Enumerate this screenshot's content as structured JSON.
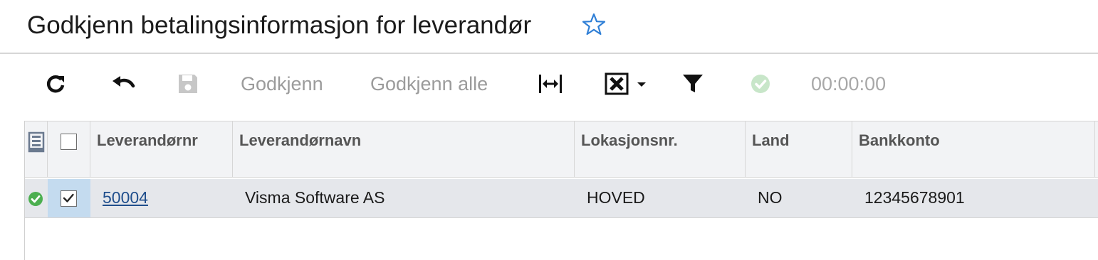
{
  "page": {
    "title": "Godkjenn betalingsinformasjon for leverandør",
    "favorite_icon": "star-outline-icon",
    "accent_color": "#2f7fd6"
  },
  "toolbar": {
    "refresh_icon": "refresh-icon",
    "undo_icon": "undo-icon",
    "save_icon": "save-icon",
    "approve_label": "Godkjenn",
    "approve_all_label": "Godkjenn alle",
    "fit_columns_icon": "fit-columns-icon",
    "export_icon": "excel-export-icon",
    "filter_icon": "filter-icon",
    "status_icon": "check-circle-icon",
    "timer": "00:00:00"
  },
  "grid": {
    "columns": {
      "vendor_number": "Leverandørnr",
      "vendor_name": "Leverandørnavn",
      "location_number": "Lokasjonsnr.",
      "country": "Land",
      "bank_account": "Bankkonto"
    },
    "rows": [
      {
        "status": "ok",
        "selected": true,
        "vendor_number": "50004",
        "vendor_name": "Visma Software AS",
        "location_number": "HOVED",
        "country": "NO",
        "bank_account": "12345678901"
      }
    ],
    "status_color": "#4caf50"
  }
}
